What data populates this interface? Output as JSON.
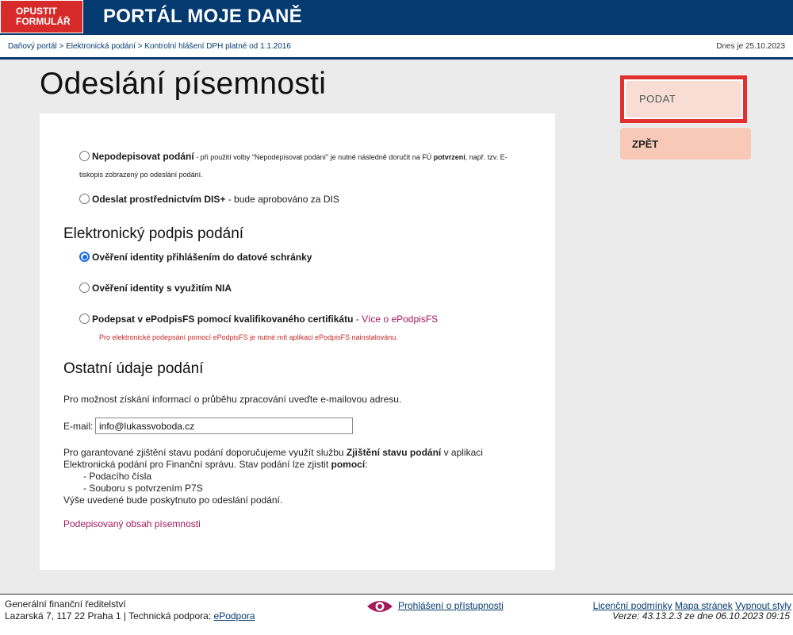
{
  "header": {
    "exit_line1": "OPUSTIT",
    "exit_line2": "FORMULÁŘ",
    "portal_title": "PORTÁL MOJE DANĚ"
  },
  "breadcrumb": {
    "items": [
      "Daňový portál",
      "Elektronická podání",
      "Kontrolní hlášení DPH platné od 1.1.2016"
    ],
    "separator": " > ",
    "today": "Dnes je 25.10.2023"
  },
  "page_title": "Odeslání písemnosti",
  "delivery_options": [
    {
      "label": "Nepodepisovat podání",
      "note": " - při použití volby \"Nepodepisovat podání\" je nutné následně doručit na FÚ ",
      "note_bold": "potvrzení",
      "note_end": ", např. tzv. E-",
      "note_line2": "tiskopis zobrazený po odeslání podání.",
      "checked": false
    },
    {
      "label": "Odeslat prostřednictvím DIS+",
      "note": " - bude aprobováno za DIS",
      "checked": false
    }
  ],
  "signature": {
    "heading": "Elektronický podpis podání",
    "options": [
      {
        "label": "Ověření identity přihlášením do datové schránky",
        "checked": true
      },
      {
        "label": "Ověření identity s využitím NIA",
        "checked": false
      },
      {
        "label": "Podepsat v ePodpisFS pomocí kvalifikovaného certifikátu",
        "dash": " - ",
        "link": "Více o ePodpisFS",
        "checked": false
      }
    ],
    "warning": "Pro elektronické podepsání pomocí ePodpisFS je nutné mít aplikaci ePodpisFS nainstalovánu."
  },
  "other": {
    "heading": "Ostatní údaje podání",
    "email_info": "Pro možnost získání informací o průběhu zpracování uveďte e-mailovou adresu.",
    "email_label": "E-mail:",
    "email_value": "info@lukassvoboda.cz",
    "para1_a": "Pro garantované zjištění stavu podání doporučujeme využít službu ",
    "para1_b": "Zjištění stavu podání",
    "para1_c": " v aplikaci",
    "para2_a": "Elektronická podání pro Finanční správu. Stav podání lze zjistit ",
    "para2_b": "pomocí",
    "para2_c": ":",
    "list": [
      "- Podacího čísla",
      "- Souboru s potvrzením P7S"
    ],
    "para3": "Výše uvedené bude poskytnuto po odeslání podání.",
    "content_link": "Podepisovaný obsah písemnosti"
  },
  "actions": {
    "submit": "PODAT",
    "back": "ZPĚT"
  },
  "footer": {
    "org": "Generální finanční ředitelství",
    "address": "Lazarská 7, 117 22 Praha 1 | Technická podpora: ",
    "support_link": "ePodpora",
    "accessibility": "Prohlášení o přístupnosti",
    "links": [
      "Licenční podmínky",
      "Mapa stránek",
      "Vypnout styly"
    ],
    "version": "Verze: 43.13.2.3 ze dne 06.10.2023 09:15"
  },
  "colors": {
    "header_bg": "#043a70",
    "exit_bg": "#d72b2b",
    "link": "#a3195b",
    "submit_bg": "#f7ddd4",
    "back_bg": "#f7c9b6",
    "highlight_border": "#e23030"
  }
}
